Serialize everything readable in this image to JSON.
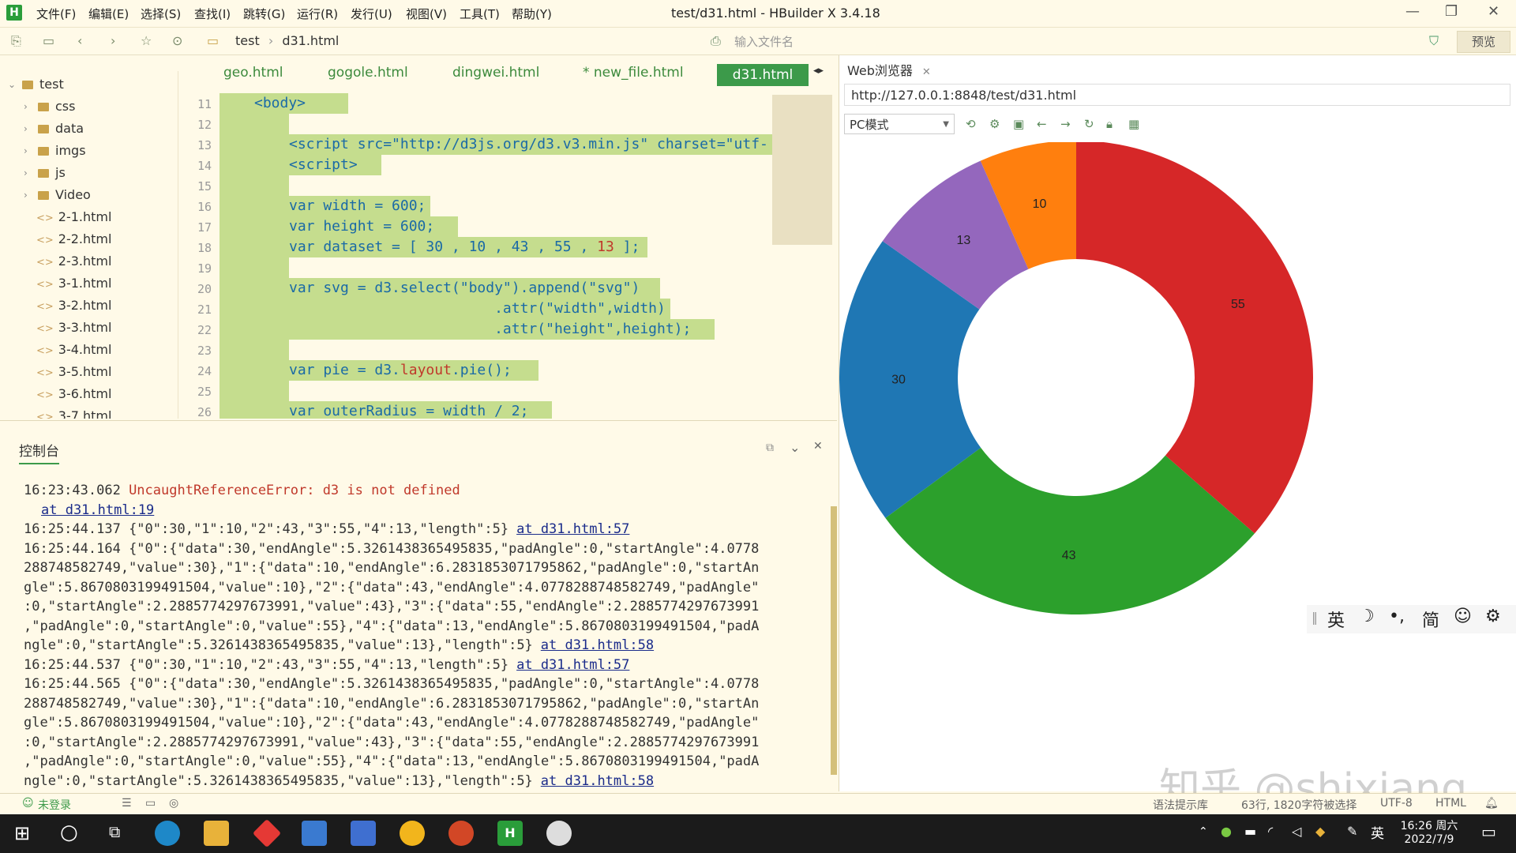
{
  "window": {
    "title": "test/d31.html - HBuilder X 3.4.18"
  },
  "menu": [
    "文件(F)",
    "编辑(E)",
    "选择(S)",
    "查找(I)",
    "跳转(G)",
    "运行(R)",
    "发行(U)",
    "视图(V)",
    "工具(T)",
    "帮助(Y)"
  ],
  "toolbar": {
    "breadcrumb_folder": "test",
    "breadcrumb_file": "d31.html",
    "file_search_placeholder": "输入文件名",
    "preview_label": "预览"
  },
  "tree": {
    "root": "test",
    "folders": [
      "css",
      "data",
      "imgs",
      "js",
      "Video"
    ],
    "files": [
      "2-1.html",
      "2-2.html",
      "2-3.html",
      "3-1.html",
      "3-2.html",
      "3-3.html",
      "3-4.html",
      "3-5.html",
      "3-6.html",
      "3-7.html"
    ]
  },
  "editor": {
    "tabs": [
      "geo.html",
      "gogole.html",
      "dingwei.html",
      "* new_file.html"
    ],
    "active_tab": "d31.html",
    "line_numbers": [
      "11",
      "12",
      "13",
      "14",
      "15",
      "16",
      "17",
      "18",
      "19",
      "20",
      "21",
      "22",
      "23",
      "24",
      "25",
      "26"
    ],
    "lines": {
      "l11": "<body>",
      "l13a": "<script src=\"http://d3js.org/d3.v3.min.js\" charset=\"utf-",
      "l14": "<script>",
      "l16": "var width = 600;",
      "l17": "var height = 600;",
      "l18a": "var dataset = [ 30 , 10 , 43 , 55 , ",
      "l18b": "13",
      "l18c": " ];",
      "l20": "var svg = d3.select(\"body\").append(\"svg\")",
      "l21": "                        .attr(\"width\",width)",
      "l22": "                        .attr(\"height\",height);",
      "l24a": "var pie = d3.",
      "l24b": "layout",
      "l24c": ".pie();",
      "l26": "var outerRadius = width / 2;"
    }
  },
  "console": {
    "tab_label": "控制台",
    "lines": [
      {
        "time": "16:23:43.062",
        "text": "UncaughtReferenceError: d3 is not defined",
        "error": true
      },
      {
        "time": "",
        "text": "",
        "link": "at d31.html:19"
      },
      {
        "time": "16:25:44.137",
        "text": "{\"0\":30,\"1\":10,\"2\":43,\"3\":55,\"4\":13,\"length\":5}",
        "link": "at d31.html:57"
      },
      {
        "time": "16:25:44.164",
        "text": "{\"0\":{\"data\":30,\"endAngle\":5.3261438365495835,\"padAngle\":0,\"startAngle\":4.0778"
      },
      {
        "time": "",
        "text": "288748582749,\"value\":30},\"1\":{\"data\":10,\"endAngle\":6.2831853071795862,\"padAngle\":0,\"startAn"
      },
      {
        "time": "",
        "text": "gle\":5.8670803199491504,\"value\":10},\"2\":{\"data\":43,\"endAngle\":4.0778288748582749,\"padAngle\""
      },
      {
        "time": "",
        "text": ":0,\"startAngle\":2.2885774297673991,\"value\":43},\"3\":{\"data\":55,\"endAngle\":2.2885774297673991"
      },
      {
        "time": "",
        "text": ",\"padAngle\":0,\"startAngle\":0,\"value\":55},\"4\":{\"data\":13,\"endAngle\":5.8670803199491504,\"padA"
      },
      {
        "time": "",
        "text": "ngle\":0,\"startAngle\":5.3261438365495835,\"value\":13},\"length\":5}",
        "link": "at d31.html:58"
      },
      {
        "time": "16:25:44.537",
        "text": "{\"0\":30,\"1\":10,\"2\":43,\"3\":55,\"4\":13,\"length\":5}",
        "link": "at d31.html:57"
      },
      {
        "time": "16:25:44.565",
        "text": "{\"0\":{\"data\":30,\"endAngle\":5.3261438365495835,\"padAngle\":0,\"startAngle\":4.0778"
      },
      {
        "time": "",
        "text": "288748582749,\"value\":30},\"1\":{\"data\":10,\"endAngle\":6.2831853071795862,\"padAngle\":0,\"startAn"
      },
      {
        "time": "",
        "text": "gle\":5.8670803199491504,\"value\":10},\"2\":{\"data\":43,\"endAngle\":4.0778288748582749,\"padAngle\""
      },
      {
        "time": "",
        "text": ":0,\"startAngle\":2.2885774297673991,\"value\":43},\"3\":{\"data\":55,\"endAngle\":2.2885774297673991"
      },
      {
        "time": "",
        "text": ",\"padAngle\":0,\"startAngle\":0,\"value\":55},\"4\":{\"data\":13,\"endAngle\":5.8670803199491504,\"padA"
      },
      {
        "time": "",
        "text": "ngle\":0,\"startAngle\":5.3261438365495835,\"value\":13},\"length\":5}",
        "link": "at d31.html:58"
      }
    ]
  },
  "browser": {
    "tab_label": "Web浏览器",
    "url": "http://127.0.0.1:8848/test/d31.html",
    "mode": "PC模式"
  },
  "chart_data": {
    "type": "pie",
    "donut": true,
    "categories": [
      "30",
      "10",
      "43",
      "55",
      "13"
    ],
    "values": [
      30,
      10,
      43,
      55,
      13
    ],
    "colors": [
      "#1f77b4",
      "#ff7f0e",
      "#2ca02c",
      "#d62728",
      "#9467bd"
    ],
    "title": ""
  },
  "ime": {
    "lang": "英",
    "moon": "☽",
    "punct": "•,",
    "simp": "简",
    "emoji": "☺",
    "settings": "⚙"
  },
  "statusbar": {
    "login": "未登录",
    "hint": "语法提示库",
    "position": "63行, 1820字符被选择",
    "encoding": "UTF-8",
    "lang": "HTML"
  },
  "watermark": "知乎 @shixiang",
  "taskbar": {
    "time": "16:26 周六",
    "date": "2022/7/9",
    "ime": "英"
  }
}
